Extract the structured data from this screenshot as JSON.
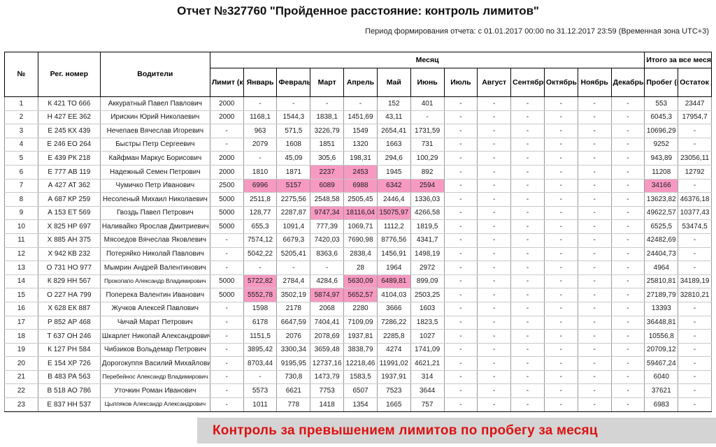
{
  "report": {
    "title": "Отчет №327760 \"Пройденное расстояние: контроль лимитов\"",
    "period": "Период формирования отчета: с 01.01.2017 00:00 по 31.12.2017 23:59 (Временная зона UTC+3)"
  },
  "legend": {
    "text": "Контроль за превышением лимитов по пробегу за месяц",
    "text_color": "#dd1111",
    "background": "#d4d4d4"
  },
  "highlight_color": "#f79ac2",
  "table": {
    "group_headers": {
      "month": "Месяц",
      "total": "Итого за все месяцы"
    },
    "columns": [
      "№",
      "Рег. номер",
      "Водители",
      "Лимит (км)",
      "Январь",
      "Февраль",
      "Март",
      "Апрель",
      "Май",
      "Июнь",
      "Июль",
      "Август",
      "Сентябрь",
      "Октябрь",
      "Ноябрь",
      "Декабрь",
      "Пробег (км)",
      "Остаток до достижения лимита (км)"
    ],
    "rows": [
      {
        "num": "1",
        "reg": "К 421 ТО 666",
        "driver": "Аккуратный Павел Павлович",
        "limit": "2000",
        "months": [
          "-",
          "-",
          "-",
          "-",
          "152",
          "401",
          "-",
          "-",
          "-",
          "-",
          "-",
          "-"
        ],
        "total": "553",
        "remainder": "23447",
        "hl": []
      },
      {
        "num": "2",
        "reg": "Н 427 ЕЕ 362",
        "driver": "Ирискин Юрий Николаевич",
        "limit": "2000",
        "months": [
          "1168,1",
          "1544,3",
          "1838,1",
          "1451,69",
          "43,11",
          "-",
          "-",
          "-",
          "-",
          "-",
          "-",
          "-"
        ],
        "total": "6045,3",
        "remainder": "17954,7",
        "hl": []
      },
      {
        "num": "3",
        "reg": "Е 245 КХ 439",
        "driver": "Нечепаев Вячеслав Игоревич",
        "limit": "-",
        "months": [
          "963",
          "571,5",
          "3226,79",
          "1549",
          "2654,41",
          "1731,59",
          "-",
          "-",
          "-",
          "-",
          "-",
          "-"
        ],
        "total": "10696,29",
        "remainder": "-",
        "hl": []
      },
      {
        "num": "4",
        "reg": "Е 246 ЕО 264",
        "driver": "Быстры Петр Сергеевич",
        "limit": "-",
        "months": [
          "2079",
          "1608",
          "1851",
          "1320",
          "1663",
          "731",
          "-",
          "-",
          "-",
          "-",
          "-",
          "-"
        ],
        "total": "9252",
        "remainder": "-",
        "hl": []
      },
      {
        "num": "5",
        "reg": "Е 439 РК 218",
        "driver": "Кайфман Маркус Борисович",
        "limit": "2000",
        "months": [
          "-",
          "45,09",
          "305,6",
          "198,31",
          "294,6",
          "100,29",
          "-",
          "-",
          "-",
          "-",
          "-",
          "-"
        ],
        "total": "943,89",
        "remainder": "23056,11",
        "hl": []
      },
      {
        "num": "6",
        "reg": "Е 777 АВ 119",
        "driver": "Надежный Семен Петрович",
        "limit": "2000",
        "months": [
          "1810",
          "1871",
          "2237",
          "2453",
          "1945",
          "892",
          "-",
          "-",
          "-",
          "-",
          "-",
          "-"
        ],
        "total": "11208",
        "remainder": "12792",
        "hl": [
          2,
          3
        ]
      },
      {
        "num": "7",
        "reg": "А 427 АТ 362",
        "driver": "Чумичко Петр Иванович",
        "limit": "2500",
        "months": [
          "6996",
          "5157",
          "6089",
          "6988",
          "6342",
          "2594",
          "-",
          "-",
          "-",
          "-",
          "-",
          "-"
        ],
        "total": "34166",
        "remainder": "-",
        "hl": [
          0,
          1,
          2,
          3,
          4,
          5
        ],
        "hl_total": true
      },
      {
        "num": "8",
        "reg": "А 687 КР 259",
        "driver": "Несоленый Михаил Николаевич",
        "limit": "5000",
        "months": [
          "2511,8",
          "2275,56",
          "2548,58",
          "2505,45",
          "2446,4",
          "1336,03",
          "-",
          "-",
          "-",
          "-",
          "-",
          "-"
        ],
        "total": "13623,82",
        "remainder": "46376,18",
        "hl": []
      },
      {
        "num": "9",
        "reg": "А 153 ЕТ 569",
        "driver": "Гвоздь Павел Петрович",
        "limit": "5000",
        "months": [
          "128,77",
          "2287,87",
          "9747,34",
          "18116,04",
          "15075,97",
          "4266,58",
          "-",
          "-",
          "-",
          "-",
          "-",
          "-"
        ],
        "total": "49622,57",
        "remainder": "10377,43",
        "hl": [
          2,
          3,
          4
        ]
      },
      {
        "num": "10",
        "reg": "Х 825 НР 697",
        "driver": "Наливайко Ярослав Дмитриевич",
        "limit": "5000",
        "months": [
          "655,3",
          "1091,4",
          "777,39",
          "1069,71",
          "1112,2",
          "1819,5",
          "-",
          "-",
          "-",
          "-",
          "-",
          "-"
        ],
        "total": "6525,5",
        "remainder": "53474,5",
        "hl": []
      },
      {
        "num": "11",
        "reg": "Х 885 АН 375",
        "driver": "Мясоедов Вячеслав Яковлевич",
        "limit": "-",
        "months": [
          "7574,12",
          "6679,3",
          "7420,03",
          "7690,98",
          "8776,56",
          "4341,7",
          "-",
          "-",
          "-",
          "-",
          "-",
          "-"
        ],
        "total": "42482,69",
        "remainder": "-",
        "hl": []
      },
      {
        "num": "12",
        "reg": "Х 942 КВ 232",
        "driver": "Потеряйко Николай Павлович",
        "limit": "-",
        "months": [
          "5042,22",
          "5205,41",
          "8363,6",
          "2838,4",
          "1456,91",
          "1498,19",
          "-",
          "-",
          "-",
          "-",
          "-",
          "-"
        ],
        "total": "24404,73",
        "remainder": "-",
        "hl": []
      },
      {
        "num": "13",
        "reg": "О 731 НО 977",
        "driver": "Мымрин Андрей Валентинович",
        "limit": "-",
        "months": [
          "-",
          "-",
          "-",
          "28",
          "1964",
          "2972",
          "-",
          "-",
          "-",
          "-",
          "-",
          "-"
        ],
        "total": "4964",
        "remainder": "-",
        "hl": []
      },
      {
        "num": "14",
        "reg": "К 829 НН 567",
        "driver": "Прокопапо Александр Владимирович",
        "driver_small": true,
        "limit": "5000",
        "months": [
          "5722,82",
          "2784,4",
          "4284,6",
          "5630,09",
          "6489,81",
          "899,09",
          "-",
          "-",
          "-",
          "-",
          "-",
          "-"
        ],
        "total": "25810,81",
        "remainder": "34189,19",
        "hl": [
          0,
          3,
          4
        ]
      },
      {
        "num": "15",
        "reg": "О 227 НА 799",
        "driver": "Поперека Валентин Иванович",
        "limit": "5000",
        "months": [
          "5552,78",
          "3502,19",
          "5874,97",
          "5652,57",
          "4104,03",
          "2503,25",
          "-",
          "-",
          "-",
          "-",
          "-",
          "-"
        ],
        "total": "27189,79",
        "remainder": "32810,21",
        "hl": [
          0,
          2,
          3
        ]
      },
      {
        "num": "16",
        "reg": "Х 628 ЕК 887",
        "driver": "Жучков Алексей Павлович",
        "limit": "-",
        "months": [
          "1598",
          "2178",
          "2068",
          "2280",
          "3666",
          "1603",
          "-",
          "-",
          "-",
          "-",
          "-",
          "-"
        ],
        "total": "13393",
        "remainder": "-",
        "hl": []
      },
      {
        "num": "17",
        "reg": "Р 852 АР 468",
        "driver": "Чичай Марат Петрович",
        "limit": "-",
        "months": [
          "6178",
          "6647,59",
          "7404,41",
          "7109,09",
          "7286,22",
          "1823,5",
          "-",
          "-",
          "-",
          "-",
          "-",
          "-"
        ],
        "total": "36448,81",
        "remainder": "-",
        "hl": []
      },
      {
        "num": "18",
        "reg": "Т 637 ОН 246",
        "driver": "Шкарлет Никопай Александрович",
        "limit": "-",
        "months": [
          "1151,5",
          "2076",
          "2078,69",
          "1937,81",
          "2285,8",
          "1027",
          "-",
          "-",
          "-",
          "-",
          "-",
          "-"
        ],
        "total": "10556,8",
        "remainder": "-",
        "hl": []
      },
      {
        "num": "19",
        "reg": "К 127 РН 584",
        "driver": "Чибзиков Вольдемар Петрович",
        "limit": "-",
        "months": [
          "3895,42",
          "3300,34",
          "3659,48",
          "3838,79",
          "4274",
          "1741,09",
          "-",
          "-",
          "-",
          "-",
          "-",
          "-"
        ],
        "total": "20709,12",
        "remainder": "-",
        "hl": []
      },
      {
        "num": "20",
        "reg": "Е 154 ХР 726",
        "driver": "Дорогокуппя Василий Михайлович",
        "limit": "-",
        "months": [
          "8703,44",
          "9195,95",
          "12737,16",
          "12218,46",
          "11991,02",
          "4621,21",
          "-",
          "-",
          "-",
          "-",
          "-",
          "-"
        ],
        "total": "59467,24",
        "remainder": "-",
        "hl": []
      },
      {
        "num": "21",
        "reg": "В 483 РА 563",
        "driver": "Перебейнос Александр Владимирович",
        "driver_small": true,
        "limit": "-",
        "months": [
          "-",
          "730,8",
          "1473,79",
          "1583,5",
          "1937,91",
          "314",
          "-",
          "-",
          "-",
          "-",
          "-",
          "-"
        ],
        "total": "6040",
        "remainder": "-",
        "hl": []
      },
      {
        "num": "22",
        "reg": "В 518 АО 786",
        "driver": "Уточкин Роман Иванович",
        "limit": "-",
        "months": [
          "5573",
          "6621",
          "7753",
          "6507",
          "7523",
          "3644",
          "-",
          "-",
          "-",
          "-",
          "-",
          "-"
        ],
        "total": "37621",
        "remainder": "-",
        "hl": []
      },
      {
        "num": "23",
        "reg": "Е 837 НН 537",
        "driver": "Цыппяков Александр Александрович",
        "driver_small": true,
        "limit": "-",
        "months": [
          "1011",
          "778",
          "1418",
          "1354",
          "1665",
          "757",
          "-",
          "-",
          "-",
          "-",
          "-",
          "-"
        ],
        "total": "6983",
        "remainder": "-",
        "hl": []
      }
    ]
  }
}
